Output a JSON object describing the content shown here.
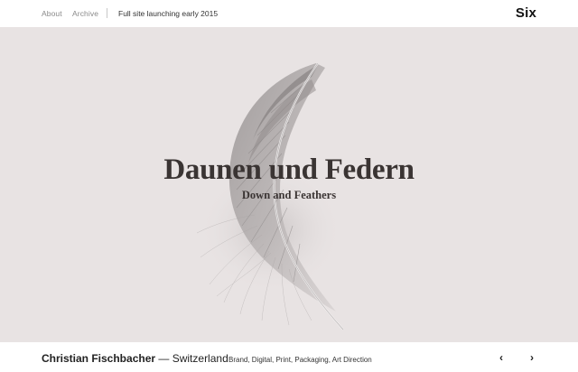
{
  "nav": {
    "about": "About",
    "archive": "Archive",
    "announcement": "Full site launching early 2015",
    "logo": "Six"
  },
  "hero": {
    "title": "Daunen und Federn",
    "subtitle": "Down and Feathers",
    "background": "#e8e3e3",
    "illustration": "feather"
  },
  "project": {
    "client": "Christian Fischbacher",
    "separator": " — ",
    "location": "Switzerland",
    "services": "Brand, Digital, Print, Packaging, Art Direction"
  },
  "pager": {
    "prev_icon": "‹",
    "next_icon": "›"
  },
  "colors": {
    "title": "#3a3433",
    "muted_nav": "#8a8a8a"
  }
}
